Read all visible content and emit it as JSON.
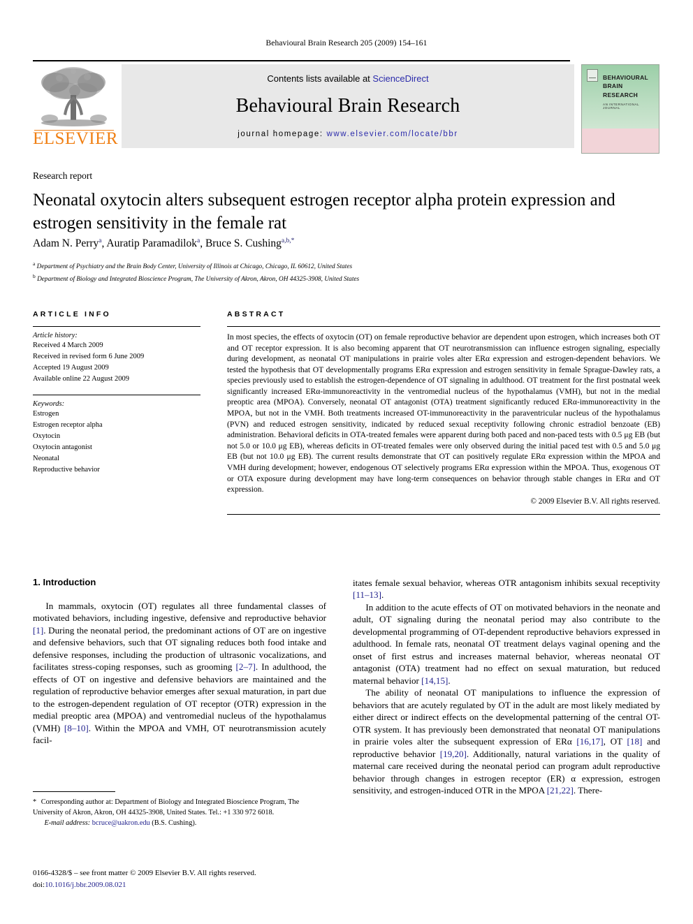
{
  "running_head": "Behavioural Brain Research 205 (2009) 154–161",
  "masthead": {
    "contents_prefix": "Contents lists available at ",
    "sciencedirect": "ScienceDirect",
    "journal_title": "Behavioural Brain Research",
    "homepage_prefix": "journal homepage: ",
    "homepage_url": "www.elsevier.com/locate/bbr",
    "publisher_wordmark": "ELSEVIER",
    "publisher_logo_icon": "elsevier-tree-icon"
  },
  "cover": {
    "title_line1": "BEHAVIOURAL",
    "title_line2": "BRAIN",
    "title_line3": "RESEARCH",
    "subtitle": "AN INTERNATIONAL JOURNAL",
    "logo_icon": "elsevier-tree-icon"
  },
  "article": {
    "type": "Research report",
    "title": "Neonatal oxytocin alters subsequent estrogen receptor alpha protein expression and estrogen sensitivity in the female rat",
    "authors_html": "Adam N. Perry<sup>a</sup>, Auratip Paramadilok<sup>a</sup>, Bruce S. Cushing<sup>a,b,</sup><sup>*</sup>",
    "affiliation_a": "Department of Psychiatry and the Brain Body Center, University of Illinois at Chicago, Chicago, IL 60612, United States",
    "affiliation_b": "Department of Biology and Integrated Bioscience Program, The University of Akron, Akron, OH 44325-3908, United States"
  },
  "article_info": {
    "heading": "ARTICLE INFO",
    "history_label": "Article history:",
    "history": [
      "Received 4 March 2009",
      "Received in revised form 6 June 2009",
      "Accepted 19 August 2009",
      "Available online 22 August 2009"
    ],
    "keywords_label": "Keywords:",
    "keywords": [
      "Estrogen",
      "Estrogen receptor alpha",
      "Oxytocin",
      "Oxytocin antagonist",
      "Neonatal",
      "Reproductive behavior"
    ]
  },
  "abstract": {
    "heading": "ABSTRACT",
    "text": "In most species, the effects of oxytocin (OT) on female reproductive behavior are dependent upon estrogen, which increases both OT and OT receptor expression. It is also becoming apparent that OT neurotransmission can influence estrogen signaling, especially during development, as neonatal OT manipulations in prairie voles alter ERα expression and estrogen-dependent behaviors. We tested the hypothesis that OT developmentally programs ERα expression and estrogen sensitivity in female Sprague-Dawley rats, a species previously used to establish the estrogen-dependence of OT signaling in adulthood. OT treatment for the first postnatal week significantly increased ERα-immunoreactivity in the ventromedial nucleus of the hypothalamus (VMH), but not in the medial preoptic area (MPOA). Conversely, neonatal OT antagonist (OTA) treatment significantly reduced ERα-immunoreactivity in the MPOA, but not in the VMH. Both treatments increased OT-immunoreactivity in the paraventricular nucleus of the hypothalamus (PVN) and reduced estrogen sensitivity, indicated by reduced sexual receptivity following chronic estradiol benzoate (EB) administration. Behavioral deficits in OTA-treated females were apparent during both paced and non-paced tests with 0.5 μg EB (but not 5.0 or 10.0 μg EB), whereas deficits in OT-treated females were only observed during the initial paced test with 0.5 and 5.0 μg EB (but not 10.0 μg EB). The current results demonstrate that OT can positively regulate ERα expression within the MPOA and VMH during development; however, endogenous OT selectively programs ERα expression within the MPOA. Thus, exogenous OT or OTA exposure during development may have long-term consequences on behavior through stable changes in ERα and OT expression.",
    "copyright": "© 2009 Elsevier B.V. All rights reserved."
  },
  "introduction": {
    "heading": "1. Introduction",
    "left_paragraph_1_html": "In mammals, oxytocin (OT) regulates all three fundamental classes of motivated behaviors, including ingestive, defensive and reproductive behavior <span class=\"ref\">[1]</span>. During the neonatal period, the predominant actions of OT are on ingestive and defensive behaviors, such that OT signaling reduces both food intake and defensive responses, including the production of ultrasonic vocalizations, and facilitates stress-coping responses, such as grooming <span class=\"ref\">[2–7]</span>. In adulthood, the effects of OT on ingestive and defensive behaviors are maintained and the regulation of reproductive behavior emerges after sexual maturation, in part due to the estrogen-dependent regulation of OT receptor (OTR) expression in the medial preoptic area (MPOA) and ventromedial nucleus of the hypothalamus (VMH) <span class=\"ref\">[8–10]</span>. Within the MPOA and VMH, OT neurotransmission acutely facil-",
    "right_paragraph_1_html": "itates female sexual behavior, whereas OTR antagonism inhibits sexual receptivity <span class=\"ref\">[11–13]</span>.",
    "right_paragraph_2_html": "In addition to the acute effects of OT on motivated behaviors in the neonate and adult, OT signaling during the neonatal period may also contribute to the developmental programming of OT-dependent reproductive behaviors expressed in adulthood. In female rats, neonatal OT treatment delays vaginal opening and the onset of first estrus and increases maternal behavior, whereas neonatal OT antagonist (OTA) treatment had no effect on sexual maturation, but reduced maternal behavior <span class=\"ref\">[14,15]</span>.",
    "right_paragraph_3_html": "The ability of neonatal OT manipulations to influence the expression of behaviors that are acutely regulated by OT in the adult are most likely mediated by either direct or indirect effects on the developmental patterning of the central OT-OTR system. It has previously been demonstrated that neonatal OT manipulations in prairie voles alter the subsequent expression of ERα <span class=\"ref\">[16,17]</span>, OT <span class=\"ref\">[18]</span> and reproductive behavior <span class=\"ref\">[19,20]</span>. Additionally, natural variations in the quality of maternal care received during the neonatal period can program adult reproductive behavior through changes in estrogen receptor (ER) α expression, estrogen sensitivity, and estrogen-induced OTR in the MPOA <span class=\"ref\">[21,22]</span>. There-"
  },
  "footnote": {
    "corresponding_html": "<span class=\"footnote-star\">*</span> Corresponding author at: Department of Biology and Integrated Bioscience Program, The University of Akron, Akron, OH 44325-3908, United States. Tel.: +1 330 972 6018.",
    "email_label": "E-mail address:",
    "email": "bcruce@uakron.edu",
    "email_owner": "(B.S. Cushing)."
  },
  "imprint": {
    "issn_line": "0166-4328/$ – see front matter © 2009 Elsevier B.V. All rights reserved.",
    "doi_label": "doi:",
    "doi_value": "10.1016/j.bbr.2009.08.021"
  },
  "colors": {
    "elsevier_orange": "#F07F13",
    "link_blue": "#2b2bab",
    "reference_blue": "#1f1f8c",
    "band_grey": "#e8e8e8",
    "cover_green": "#9ccfa8",
    "cover_pink": "#f2d4d8"
  }
}
